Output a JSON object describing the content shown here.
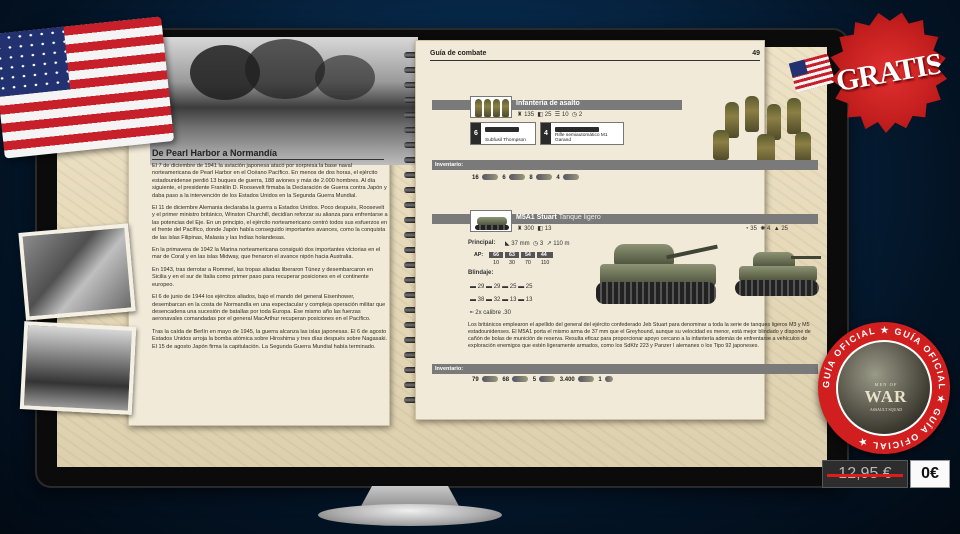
{
  "left_page": {
    "title": "De Pearl Harbor a Normandía",
    "paragraphs": [
      "El 7 de diciembre de 1941 la aviación japonesa atacó por sorpresa la base naval norteamericana de Pearl Harbor en el Océano Pacífico. En menos de dos horas, el ejército estadounidense perdió 13 buques de guerra, 188 aviones y más de 2.000 hombres. Al día siguiente, el presidente Franklin D. Roosevelt firmaba la Declaración de Guerra contra Japón y daba paso a la intervención de los Estados Unidos en la Segunda Guerra Mundial.",
      "El 11 de diciembre Alemania declaraba la guerra a Estados Unidos. Poco después, Roosevelt y el primer ministro británico, Winston Churchill, decidían reforzar su alianza para enfrentarse a las potencias del Eje. En un principio, el ejército norteamericano centró todos sus esfuerzos en el frente del Pacífico, donde Japón había conseguido importantes avances, como la conquista de las islas Filipinas, Malasia y las Indias holandesas.",
      "En la primavera de 1942 la Marina norteamericana consiguió dos importantes victorias en el mar de Coral y en las islas Midway, que frenaron el avance nipón hacia Australia.",
      "En 1943, tras derrotar a Rommel, las tropas aliadas liberaron Túnez y desembarcaron en Sicilia y en el sur de Italia como primer paso para recuperar posiciones en el continente europeo.",
      "El 6 de junio de 1944 los ejércitos aliados, bajo el mando del general Eisenhower, desembarcan en la costa de Normandía en una espectacular y compleja operación militar que desencadena una sucesión de batallas por toda Europa. Ese mismo año las fuerzas aeronavales comandadas por el general MacArthur recuperan posiciones en el Pacífico.",
      "Tras la caída de Berlín en mayo de 1945, la guerra alcanza las islas japonesas. El 6 de agosto Estados Unidos arroja la bomba atómica sobre Hiroshima y tres días después sobre Nagasaki. El 15 de agosto Japón firma la capitulación. La Segunda Guerra Mundial había terminado."
    ]
  },
  "right_page": {
    "header": "Guía de combate",
    "page_number": "49",
    "infantry": {
      "name": "Infantería de asalto",
      "stats": [
        "135",
        "25",
        "10",
        "2"
      ],
      "weapons": [
        {
          "count": "6",
          "name": "Subfusil Thompson"
        },
        {
          "count": "4",
          "name": "Rifle semiautomático M1 Garand"
        }
      ],
      "inventory_label": "Inventario:",
      "inventory": [
        "16",
        "6",
        "8",
        "4"
      ]
    },
    "tank": {
      "name": "M5A1 Stuart",
      "subtitle": "Tanque ligero",
      "stats": [
        "300",
        "13"
      ],
      "stats_right": [
        "35",
        "4",
        "25"
      ],
      "principal_label": "Principal:",
      "principal": [
        "37",
        "3",
        "110"
      ],
      "ap_label": "AP:",
      "ap_values": [
        "66",
        "63",
        "54",
        "44"
      ],
      "ap_ranges": [
        "10",
        "30",
        "70",
        "110"
      ],
      "armor_label": "Blindaje:",
      "armor": [
        "29",
        "29",
        "25",
        "25",
        "38",
        "32",
        "13",
        "13"
      ],
      "secondary": "2x calibre .30",
      "description": "Los británicos emplearon el apellido del general del ejército confederado Jeb Stuart para denominar a toda la serie de tanques ligeros M3 y M5 estadounidenses. El M5A1 porta el mismo arma de 37 mm que el Greyhound, aunque su velocidad es menor, está mejor blindado y dispone de cañón de bolas de munición de reserva. Resulta eficaz para proporcionar apoyo cercano a la infantería además de enfrentarse a vehículos de exploración enemigos que estén ligeramente armados, como los SdKfz 223 y Panzer I alemanes o los Tipo 92 japoneses.",
      "inventory_label": "Inventario:",
      "inventory": [
        "79",
        "68",
        "5",
        "3.400",
        "1"
      ]
    }
  },
  "promo": {
    "gratis": "GRATIS",
    "badge_text": "GUÍA OFICIAL ★ GUÍA OFICIAL ★ GUÍA OFICIAL ★",
    "game_top": "MEN OF",
    "game_word": "WAR",
    "game_bottom": "ASSAULT SQUAD",
    "old_price": "12,95 €",
    "new_price": "0€"
  },
  "colors": {
    "accent_red": "#d11f1f",
    "strike": "#e11b1b",
    "band_gray": "#7a7a7a"
  },
  "icons": [
    "soldier-icon",
    "tank-icon",
    "ammo-icon",
    "shell-icon",
    "grenade-icon",
    "star-icon"
  ]
}
